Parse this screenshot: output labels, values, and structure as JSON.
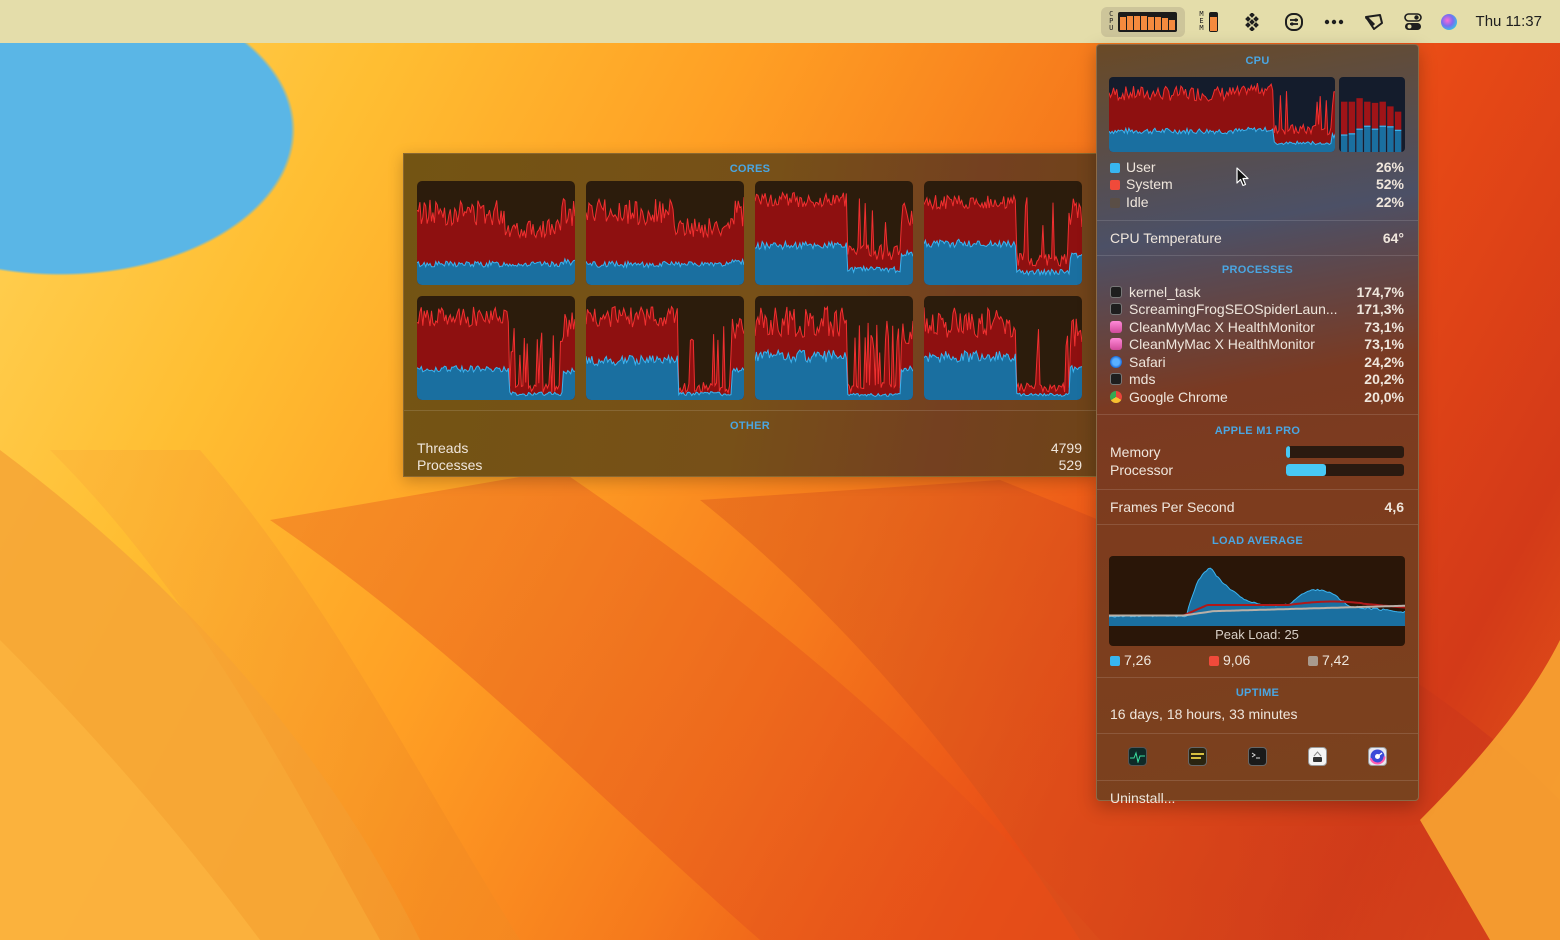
{
  "menubar": {
    "cpu_label": [
      "C",
      "P",
      "U"
    ],
    "mem_label": [
      "M",
      "E",
      "M"
    ],
    "cpu_core_levels": [
      0.8,
      0.82,
      0.86,
      0.82,
      0.8,
      0.78,
      0.72,
      0.6
    ],
    "mem_level": 0.82,
    "icons": [
      "cpu-meter-icon",
      "memory-meter-icon",
      "dropbox-icon",
      "control-icon",
      "more-icon",
      "tap-icon",
      "control-center-icon",
      "siri-icon"
    ],
    "clock": "Thu 11:37",
    "accent": "#f48a3e"
  },
  "cpu_panel": {
    "title": "CPU",
    "legend": [
      {
        "label": "User",
        "value": "26%",
        "color": "#38b6f0"
      },
      {
        "label": "System",
        "value": "52%",
        "color": "#f04a3a"
      },
      {
        "label": "Idle",
        "value": "22%",
        "color": "#5a4e46"
      }
    ],
    "temperature": {
      "label": "CPU Temperature",
      "value": "64°"
    },
    "processes_title": "PROCESSES",
    "processes": [
      {
        "name": "kernel_task",
        "value": "174,7%",
        "icon": "terminal-icon"
      },
      {
        "name": "ScreamingFrogSEOSpiderLaun...",
        "value": "171,3%",
        "icon": "terminal-icon"
      },
      {
        "name": "CleanMyMac X HealthMonitor",
        "value": "73,1%",
        "icon": "cleanmymac-icon"
      },
      {
        "name": "CleanMyMac X HealthMonitor",
        "value": "73,1%",
        "icon": "cleanmymac-icon"
      },
      {
        "name": "Safari",
        "value": "24,2%",
        "icon": "safari-icon"
      },
      {
        "name": "mds",
        "value": "20,2%",
        "icon": "terminal-icon"
      },
      {
        "name": "Google Chrome",
        "value": "20,0%",
        "icon": "chrome-icon"
      }
    ],
    "gpu_title": "APPLE M1 PRO",
    "gpu": [
      {
        "label": "Memory",
        "fraction": 0.03
      },
      {
        "label": "Processor",
        "fraction": 0.34
      }
    ],
    "fps": {
      "label": "Frames Per Second",
      "value": "4,6"
    },
    "load_title": "LOAD AVERAGE",
    "peak_load": "Peak Load: 25",
    "load_values": [
      {
        "value": "7,26",
        "color": "#38b6f0"
      },
      {
        "value": "9,06",
        "color": "#f04a3a"
      },
      {
        "value": "7,42",
        "color": "#a89a8e"
      }
    ],
    "uptime_title": "UPTIME",
    "uptime": "16 days, 18 hours, 33 minutes",
    "apps": [
      "activity-monitor-icon",
      "console-icon",
      "terminal-icon",
      "system-information-icon",
      "istat-icon"
    ],
    "uninstall": "Uninstall..."
  },
  "cores_window": {
    "title": "CORES",
    "core_count": 8,
    "other_title": "OTHER",
    "threads": {
      "label": "Threads",
      "value": "4799"
    },
    "processes": {
      "label": "Processes",
      "value": "529"
    }
  },
  "history_bars": {
    "system": [
      0.86,
      0.86,
      0.92,
      0.86,
      0.84,
      0.86,
      0.78,
      0.69
    ],
    "user": [
      0.3,
      0.32,
      0.4,
      0.45,
      0.4,
      0.45,
      0.44,
      0.38
    ]
  },
  "colors": {
    "user": "#1a6fa0",
    "user_line": "#3cb4f0",
    "system": "#8e1010",
    "system_line": "#f03030",
    "section_title": "#4aa6e2"
  }
}
